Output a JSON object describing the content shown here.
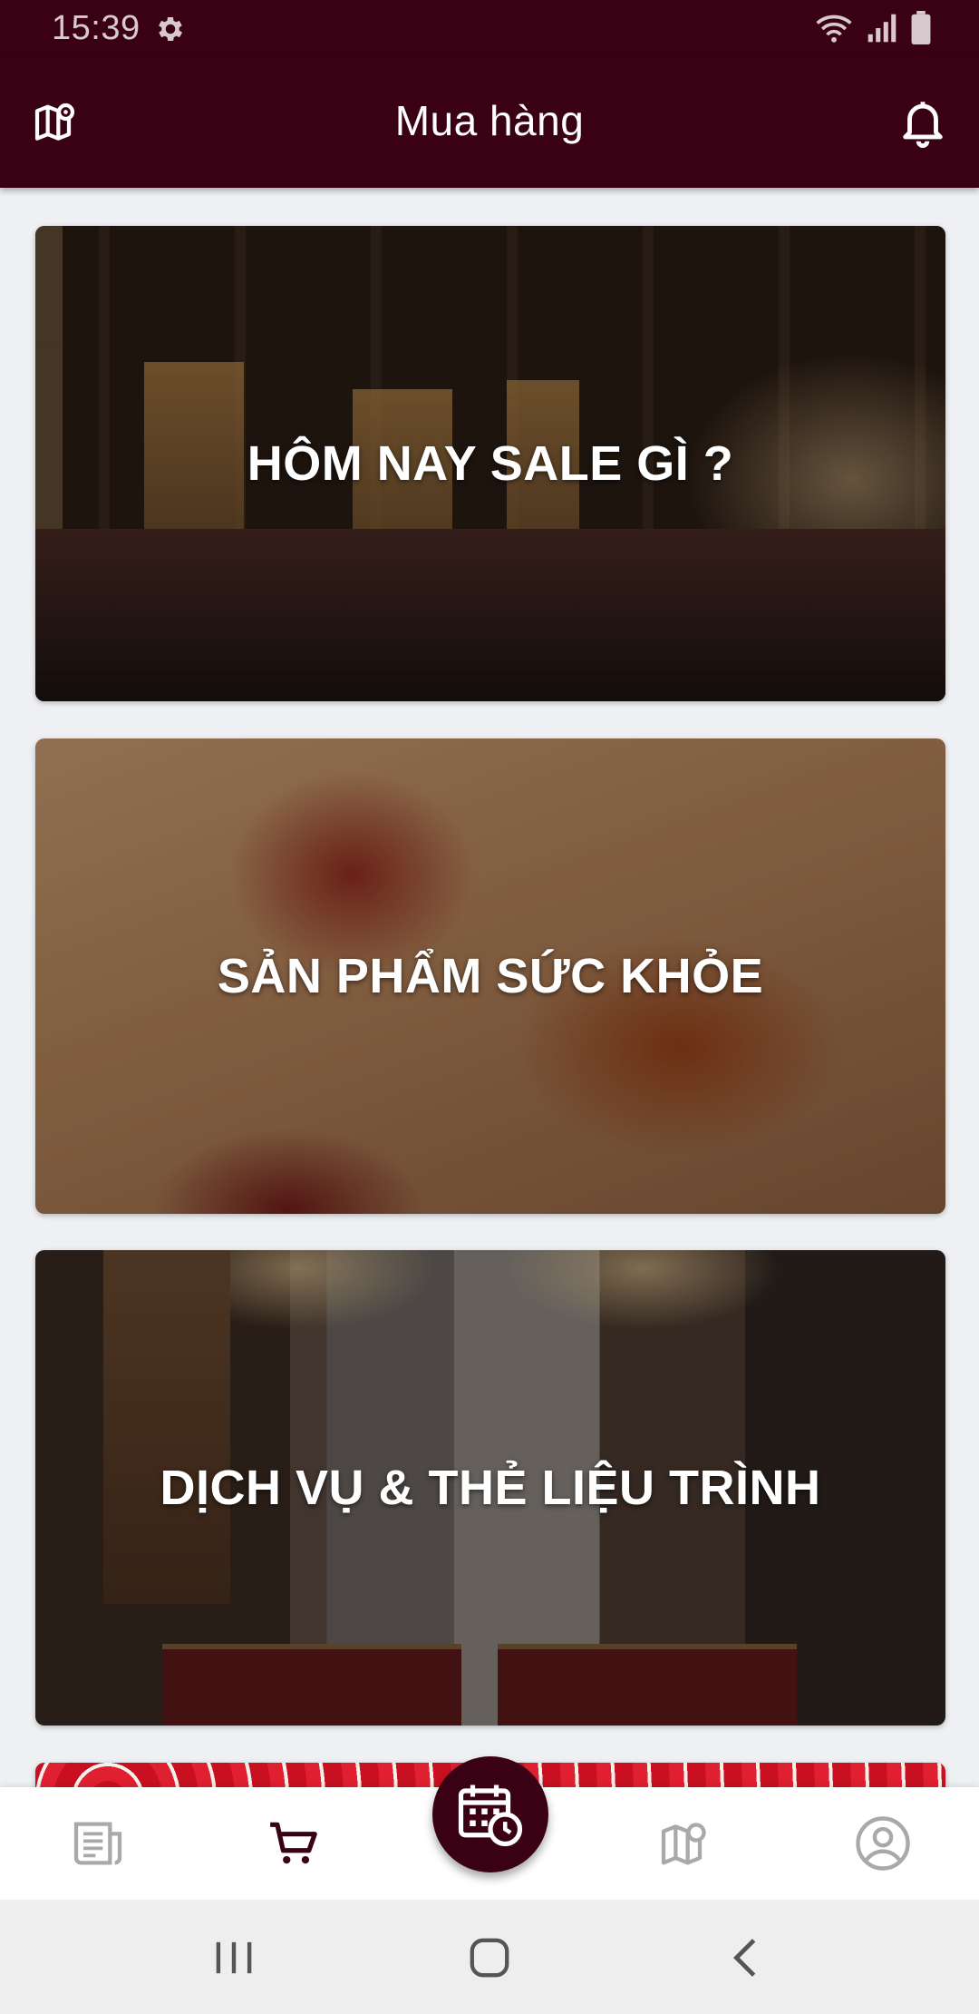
{
  "status_bar": {
    "time": "15:39",
    "icons": [
      "settings-gear-icon",
      "wifi-icon",
      "signal-icon",
      "battery-icon"
    ]
  },
  "app_bar": {
    "title": "Mua hàng",
    "left_icon": "map-pin-icon",
    "right_icon": "bell-icon"
  },
  "cards": [
    {
      "title": "HÔM NAY SALE GÌ ?",
      "image": "spa-interior"
    },
    {
      "title": "SẢN PHẨM SỨC KHỎE",
      "image": "jujube-tea"
    },
    {
      "title": "DỊCH VỤ & THẺ LIỆU TRÌNH",
      "image": "spa-treatment-room"
    },
    {
      "title": "",
      "image": "red-pattern"
    }
  ],
  "bottom_nav": {
    "items": [
      "news-icon",
      "cart-icon",
      "calendar-clock-icon",
      "map-pin-icon",
      "account-icon"
    ],
    "active": "cart-icon"
  },
  "colors": {
    "primary": "#3a0014",
    "background": "#eef0f3",
    "icon_inactive": "#a9a9a9"
  },
  "system_nav": {
    "buttons": [
      "recent-apps",
      "home",
      "back"
    ]
  }
}
